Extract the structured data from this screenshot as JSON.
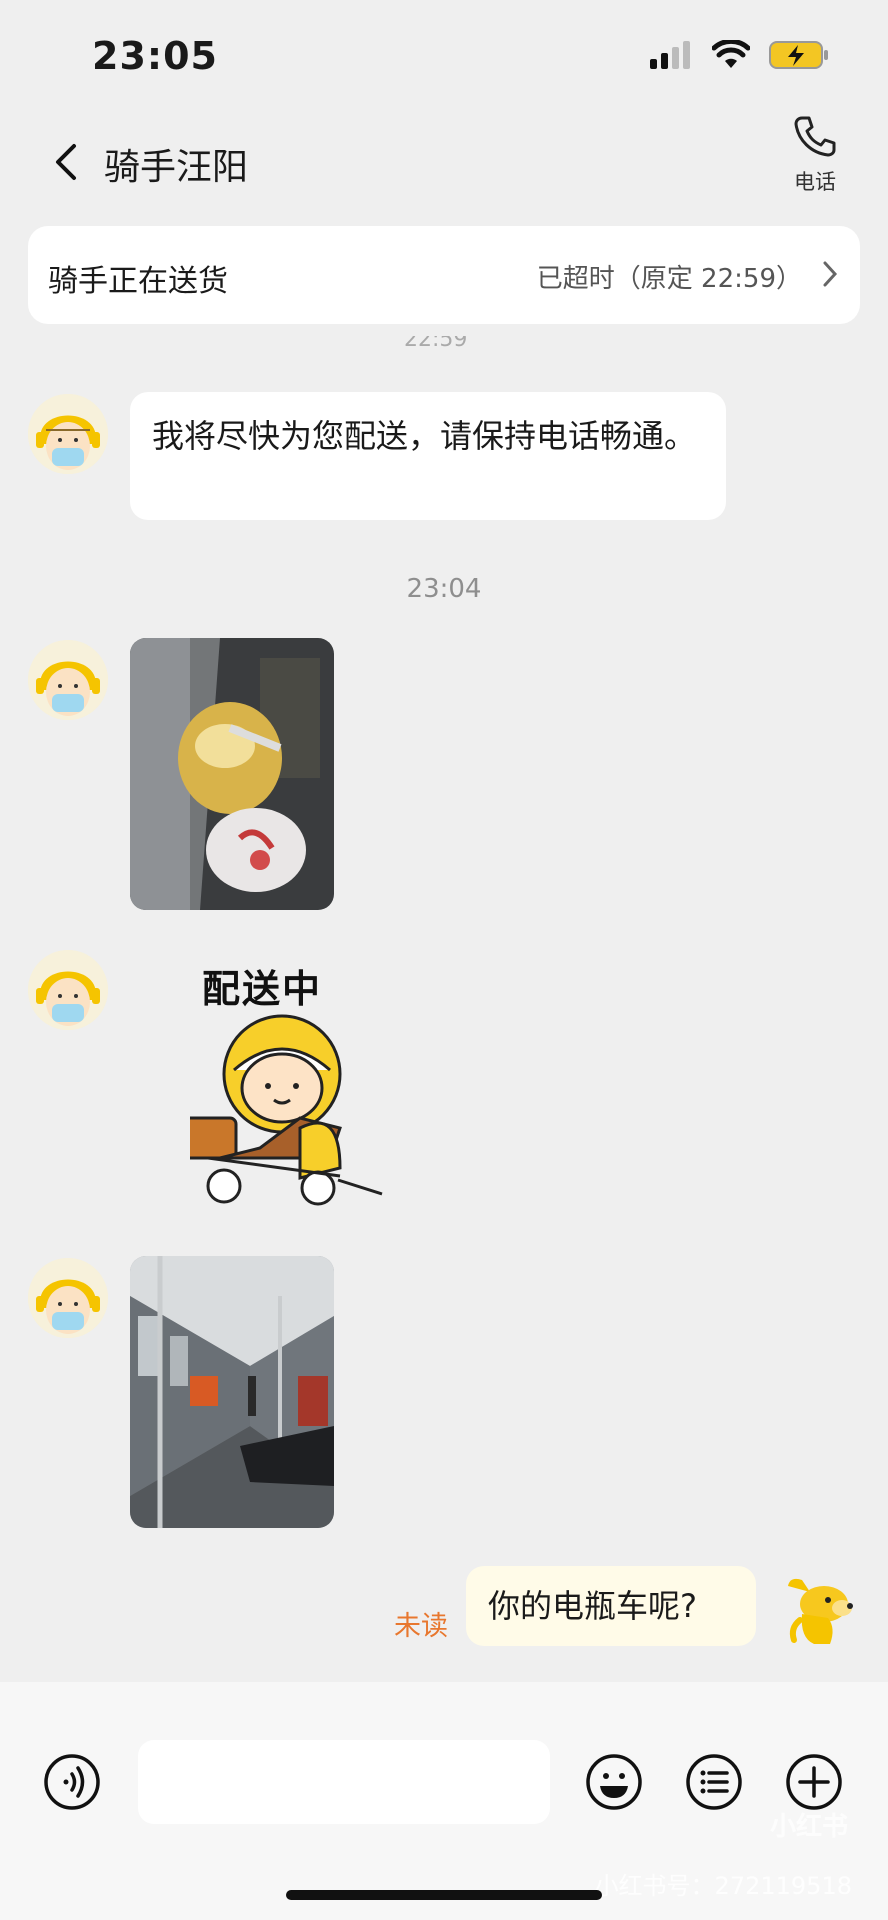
{
  "status_bar": {
    "time": "23:05"
  },
  "header": {
    "title": "骑手汪阳",
    "call_label": "电话"
  },
  "banner": {
    "text": "骑手正在送货",
    "status": "已超时（原定 22:59）"
  },
  "messages": {
    "partial_time": "22:59",
    "first_text": "我将尽快为您配送，请保持电话畅通。",
    "divider_time": "23:04",
    "sticker_text": "配送中",
    "unread_label": "未读",
    "my_text": "你的电瓶车呢?"
  },
  "watermark": {
    "logo": "小红书",
    "id": "小红书号：272119518"
  },
  "colors": {
    "background": "#efefef",
    "unread": "#e8772e",
    "accent_yellow": "#f5c400"
  }
}
